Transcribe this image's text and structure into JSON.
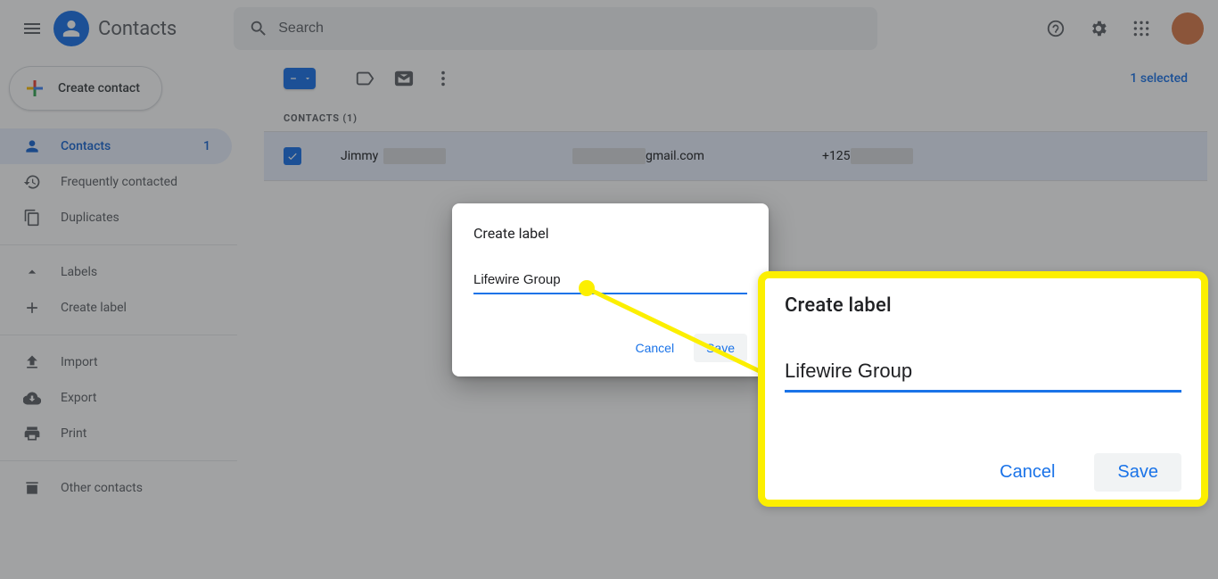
{
  "header": {
    "app_title": "Contacts",
    "search_placeholder": "Search"
  },
  "sidebar": {
    "create_label": "Create contact",
    "items": {
      "contacts": {
        "label": "Contacts",
        "count": "1"
      },
      "frequent": {
        "label": "Frequently contacted"
      },
      "duplicates": {
        "label": "Duplicates"
      },
      "labels_header": "Labels",
      "create_label": "Create label",
      "import": "Import",
      "export": "Export",
      "print": "Print",
      "other": "Other contacts"
    }
  },
  "toolbar": {
    "selected_text": "1 selected"
  },
  "list": {
    "section_header": "CONTACTS (1)",
    "row": {
      "name": "Jimmy",
      "email_suffix": "gmail.com",
      "phone_prefix": "+125"
    }
  },
  "dialog": {
    "title": "Create label",
    "value": "Lifewire Group",
    "cancel": "Cancel",
    "save": "Save"
  },
  "callout": {
    "title": "Create label",
    "value": "Lifewire Group",
    "cancel": "Cancel",
    "save": "Save"
  }
}
